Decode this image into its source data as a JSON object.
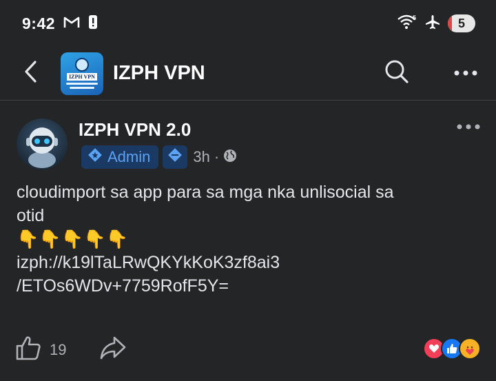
{
  "status_bar": {
    "time": "9:42",
    "notification_icons": [
      "gmail-icon",
      "alert-icon"
    ],
    "system_icons": [
      "wifi-icon",
      "airplane-icon"
    ],
    "battery_level": "5"
  },
  "header": {
    "back_icon": "back-arrow-icon",
    "group_avatar_text": "IZPH VPN",
    "title": "IZPH VPN",
    "search_icon": "search-icon",
    "more_icon": "more-icon"
  },
  "post": {
    "author": "IZPH VPN 2.0",
    "role_badge": "Admin",
    "time": "3h",
    "separator": "·",
    "privacy_icon": "globe-icon",
    "text_line1": "cloudimport sa app para sa mga nka unlisocial sa",
    "text_line2": "otid",
    "emojis": [
      "👇",
      "👇",
      "👇",
      "👇",
      "👇"
    ],
    "link_line1": "izph://k19lTaLRwQKYkKoK3zf8ai3",
    "link_line2": "/ETOs6WDv+7759RofF5Y=",
    "like_count": "19",
    "reactions": [
      "love",
      "like",
      "care"
    ]
  },
  "colors": {
    "background": "#242526",
    "badge_bg": "#1a3a63",
    "badge_text": "#5ba2f5",
    "text_primary": "#e4e6eb",
    "text_secondary": "#b0b3b8"
  }
}
